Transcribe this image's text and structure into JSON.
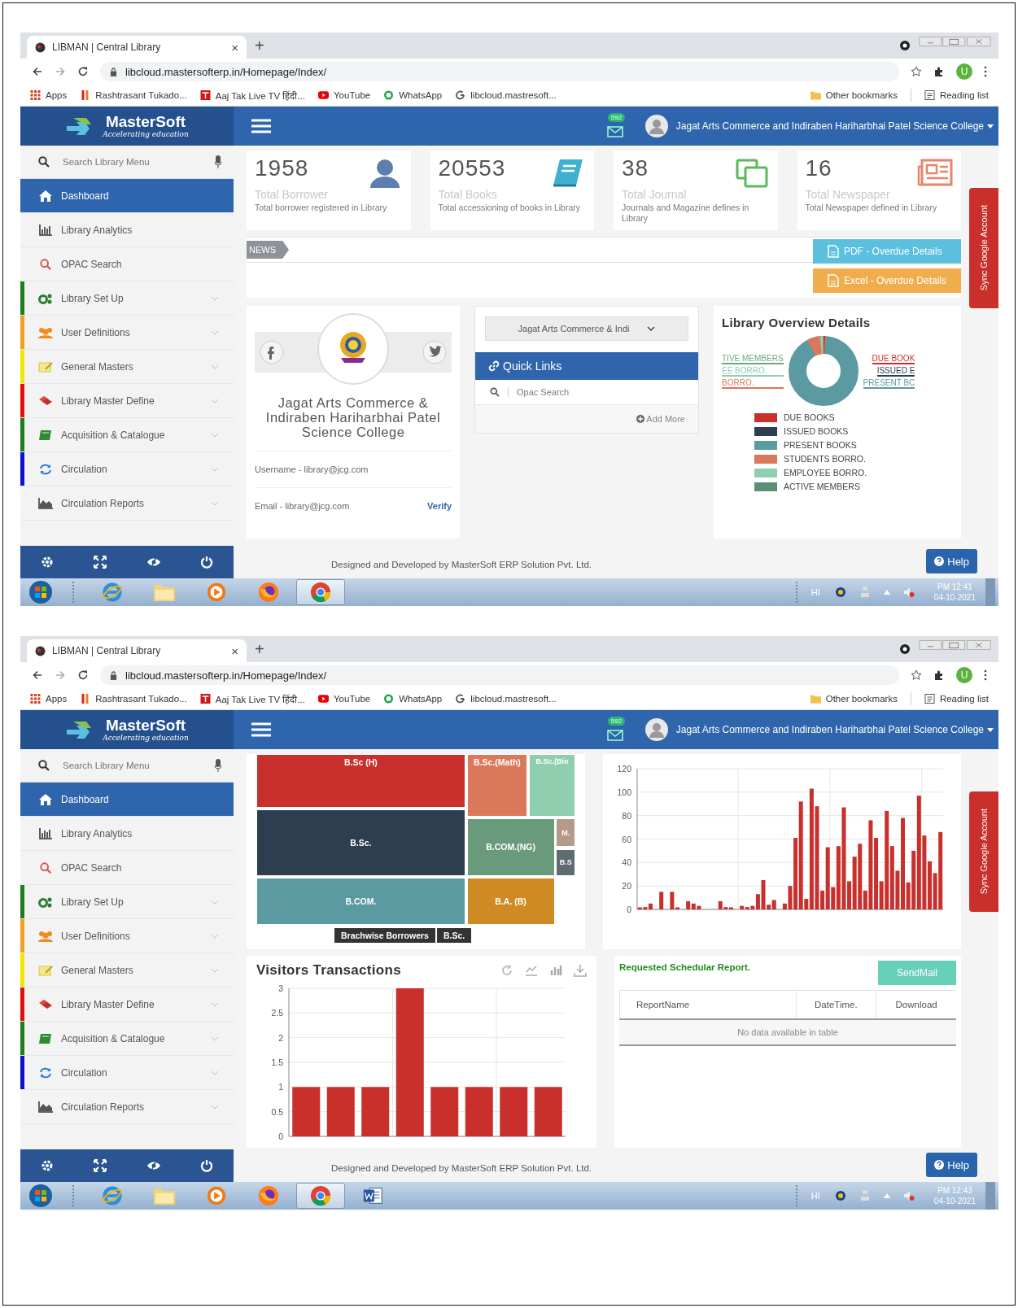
{
  "screens": [
    {
      "kind": "overview",
      "browser": {
        "tab_title": "LIBMAN | Central Library",
        "tab_close": "×",
        "new_tab": "+",
        "url": "libcloud.mastersofterp.in/Homepage/Index/",
        "profile": "U",
        "bookmarks": [
          {
            "kind": "apps",
            "label": "Apps"
          },
          {
            "kind": "bars",
            "label": "Rashtrasant Tukado..."
          },
          {
            "kind": "tv",
            "label": "Aaj Tak Live TV हिंदी..."
          },
          {
            "kind": "video",
            "label": "YouTube"
          },
          {
            "kind": "chat",
            "label": "WhatsApp"
          },
          {
            "kind": "g",
            "label": "libcloud.mastresoft..."
          }
        ],
        "bookmarks_right": [
          "Other bookmarks",
          "Reading list"
        ]
      },
      "header": {
        "brand": "MasterSoft",
        "tagline": "Accelerating education",
        "badge": "592",
        "college": "Jagat Arts Commerce and Indiraben Hariharbhai Patel Science College"
      },
      "sidebar": {
        "search_placeholder": "Search Library Menu",
        "items": [
          {
            "label": "Dashboard",
            "kind": "home",
            "selected": true,
            "expandable": false
          },
          {
            "label": "Library Analytics",
            "kind": "analytics",
            "selected": false,
            "expandable": false
          },
          {
            "label": "OPAC Search",
            "kind": "search",
            "selected": false,
            "expandable": false
          },
          {
            "label": "Library Set Up",
            "kind": "gears",
            "selected": false,
            "expandable": true,
            "color": "#1e7d1e"
          },
          {
            "label": "User Definitions",
            "kind": "users",
            "selected": false,
            "expandable": true,
            "color": "#f0a020"
          },
          {
            "label": "General Masters",
            "kind": "note",
            "selected": false,
            "expandable": true,
            "color": "#f5e600"
          },
          {
            "label": "Library Master Define",
            "kind": "layers",
            "selected": false,
            "expandable": true,
            "color": "#e01010"
          },
          {
            "label": "Acquisition & Catalogue",
            "kind": "book",
            "selected": false,
            "expandable": true,
            "color": "#1e7d1e"
          },
          {
            "label": "Circulation",
            "kind": "refresh",
            "selected": false,
            "expandable": true,
            "color": "#1010d0"
          },
          {
            "label": "Circulation Reports",
            "kind": "report",
            "selected": false,
            "expandable": true
          }
        ]
      },
      "content": {
        "stats": [
          {
            "kind": "user",
            "value": "1958",
            "title": "Total Borrower",
            "desc": "Total borrower registered in Library"
          },
          {
            "kind": "book",
            "value": "20553",
            "title": "Total Books",
            "desc": "Total accessioning of books in Library"
          },
          {
            "kind": "journal",
            "value": "38",
            "title": "Total Journal",
            "desc": "Journals and Magazine defines in Library"
          },
          {
            "kind": "newspaper",
            "value": "16",
            "title": "Total Newspaper",
            "desc": "Total Newspaper defined in Library"
          }
        ],
        "news": {
          "label": "NEWS",
          "buttons": [
            {
              "kind": "pdf",
              "label": "PDF - Overdue Details"
            },
            {
              "kind": "excel",
              "label": "Excel - Overdue Details"
            }
          ]
        },
        "profile": {
          "name": "Jagat Arts Commerce & Indiraben Hariharbhai Patel Science College",
          "username": "Username - library@jcg.com",
          "email": "Email - library@jcg.com",
          "verify": "Verify"
        },
        "quick_links": {
          "select": "Jagat Arts Commerce & Indi",
          "title": "Quick Links",
          "links": [
            "Opac Search"
          ],
          "add_more": "Add More"
        },
        "overview": {
          "title": "Library Overview Details",
          "callouts": [
            {
              "label": "TIVE MEMBERS",
              "color": "#6aa88a"
            },
            {
              "label": "EE BORRO.",
              "color": "#8fcfb0"
            },
            {
              "label": "BORRO.",
              "color": "#d9785a"
            },
            {
              "label": "DUE BOOK",
              "color": "#c9302c"
            },
            {
              "label": "ISSUED E",
              "color": "#2c3e50"
            },
            {
              "label": "PRESENT BC",
              "color": "#5b9aa0"
            }
          ],
          "legend": [
            {
              "label": "DUE BOOKS",
              "color": "#c9302c"
            },
            {
              "label": "ISSUED BOOKS",
              "color": "#2c3e50"
            },
            {
              "label": "PRESENT BOOKS",
              "color": "#5b9aa0"
            },
            {
              "label": "STUDENTS BORRO.",
              "color": "#d9785a"
            },
            {
              "label": "EMPLOYEE BORRO.",
              "color": "#8fcfb0"
            },
            {
              "label": "ACTIVE MEMBERS",
              "color": "#5e8f74"
            }
          ]
        }
      },
      "footer": "Designed and Developed by MasterSoft ERP Solution Pvt. Ltd.",
      "help": "Help",
      "sync_tab": "Sync Google Account",
      "taskbar": {
        "apps": [
          {
            "kind": "ie",
            "selected": false
          },
          {
            "kind": "folder",
            "selected": false
          },
          {
            "kind": "media",
            "selected": false
          },
          {
            "kind": "firefox",
            "selected": false
          },
          {
            "kind": "chrome",
            "selected": true
          }
        ],
        "language": "HI",
        "time": "PM 12:41",
        "date": "04-10-2021"
      }
    },
    {
      "kind": "charts",
      "browser": {
        "tab_title": "LIBMAN | Central Library",
        "tab_close": "×",
        "new_tab": "+",
        "url": "libcloud.mastersofterp.in/Homepage/Index/",
        "profile": "U",
        "bookmarks": [
          {
            "kind": "apps",
            "label": "Apps"
          },
          {
            "kind": "bars",
            "label": "Rashtrasant Tukado..."
          },
          {
            "kind": "tv",
            "label": "Aaj Tak Live TV हिंदी..."
          },
          {
            "kind": "video",
            "label": "YouTube"
          },
          {
            "kind": "chat",
            "label": "WhatsApp"
          },
          {
            "kind": "g",
            "label": "libcloud.mastresoft..."
          }
        ],
        "bookmarks_right": [
          "Other bookmarks",
          "Reading list"
        ]
      },
      "header": {
        "brand": "MasterSoft",
        "tagline": "Accelerating education",
        "badge": "592",
        "college": "Jagat Arts Commerce and Indiraben Hariharbhai Patel Science College"
      },
      "sidebar": {
        "search_placeholder": "Search Library Menu",
        "items": [
          {
            "label": "Dashboard",
            "kind": "home",
            "selected": true,
            "expandable": false
          },
          {
            "label": "Library Analytics",
            "kind": "analytics",
            "selected": false,
            "expandable": false
          },
          {
            "label": "OPAC Search",
            "kind": "search",
            "selected": false,
            "expandable": false
          },
          {
            "label": "Library Set Up",
            "kind": "gears",
            "selected": false,
            "expandable": true,
            "color": "#1e7d1e"
          },
          {
            "label": "User Definitions",
            "kind": "users",
            "selected": false,
            "expandable": true,
            "color": "#f0a020"
          },
          {
            "label": "General Masters",
            "kind": "note",
            "selected": false,
            "expandable": true,
            "color": "#f5e600"
          },
          {
            "label": "Library Master Define",
            "kind": "layers",
            "selected": false,
            "expandable": true,
            "color": "#e01010"
          },
          {
            "label": "Acquisition & Catalogue",
            "kind": "book",
            "selected": false,
            "expandable": true,
            "color": "#1e7d1e"
          },
          {
            "label": "Circulation",
            "kind": "refresh",
            "selected": false,
            "expandable": true,
            "color": "#1010d0"
          },
          {
            "label": "Circulation Reports",
            "kind": "report",
            "selected": false,
            "expandable": true
          }
        ]
      },
      "content": {
        "treemap": {
          "tiles": [
            {
              "label": "B.Sc (H)",
              "color": "#c9302c"
            },
            {
              "label": "B.Sc.",
              "color": "#2c3e50"
            },
            {
              "label": "B.COM.",
              "color": "#5b9aa0"
            },
            {
              "label": "B.Sc.(Math)",
              "color": "#d9785a"
            },
            {
              "label": "B.Sc.(Bio",
              "color": "#8fcfb0"
            },
            {
              "label": "B.COM.(NG)",
              "color": "#6a9a7c"
            },
            {
              "label": "M.",
              "color": "#b59a8a"
            },
            {
              "label": "B.S",
              "color": "#5f6b73"
            },
            {
              "label": "B.A. (B)",
              "color": "#d08a24"
            }
          ],
          "breadcrumb": [
            "Brachwise Borrowers",
            "B.Sc."
          ]
        },
        "top_chart": {
          "chart_data": {
            "type": "bar",
            "grid": true,
            "ylim": [
              0,
              120
            ],
            "yticks": [
              0,
              20,
              40,
              60,
              80,
              100,
              120
            ],
            "values": [
              1,
              2,
              5,
              0,
              15,
              0,
              15,
              1,
              0,
              7,
              5,
              3,
              0,
              0,
              0,
              7,
              2,
              1,
              0,
              3,
              2,
              3,
              13,
              25,
              4,
              8,
              0,
              5,
              20,
              61,
              92,
              9,
              103,
              88,
              16,
              53,
              19,
              54,
              87,
              24,
              45,
              56,
              16,
              76,
              61,
              24,
              84,
              54,
              33,
              78,
              23,
              50,
              97,
              63,
              41,
              31,
              66
            ]
          }
        },
        "visitors": {
          "chart_data": {
            "type": "bar",
            "grid": true,
            "title": "Visitors Transactions",
            "ylim": [
              0,
              3
            ],
            "yticks": [
              0,
              0.5,
              1,
              1.5,
              2,
              2.5,
              3
            ],
            "values": [
              1,
              1,
              1,
              3,
              1,
              1,
              1,
              1
            ]
          }
        },
        "report": {
          "title": "Requested Schedular Report.",
          "button": "SendMail",
          "columns": [
            "ReportName",
            "DateTime.",
            "Download"
          ],
          "empty": "No data available in table"
        }
      },
      "footer": "Designed and Developed by MasterSoft ERP Solution Pvt. Ltd.",
      "help": "Help",
      "sync_tab": "Sync Google Account",
      "taskbar": {
        "apps": [
          {
            "kind": "ie",
            "selected": false
          },
          {
            "kind": "folder",
            "selected": false
          },
          {
            "kind": "media",
            "selected": false
          },
          {
            "kind": "firefox",
            "selected": false
          },
          {
            "kind": "chrome",
            "selected": true
          },
          {
            "kind": "word",
            "selected": false
          }
        ],
        "language": "HI",
        "time": "PM 12:43",
        "date": "04-10-2021"
      }
    }
  ]
}
